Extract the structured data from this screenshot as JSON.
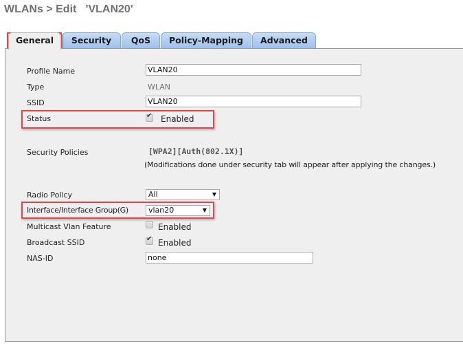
{
  "header": {
    "title": "WLANs > Edit   'VLAN20'"
  },
  "tabs": [
    {
      "label": "General",
      "active": true
    },
    {
      "label": "Security",
      "active": false
    },
    {
      "label": "QoS",
      "active": false
    },
    {
      "label": "Policy-Mapping",
      "active": false
    },
    {
      "label": "Advanced",
      "active": false
    }
  ],
  "general": {
    "profile_name": {
      "label": "Profile Name",
      "value": "VLAN20"
    },
    "type": {
      "label": "Type",
      "value": "WLAN"
    },
    "ssid": {
      "label": "SSID",
      "value": "VLAN20"
    },
    "status": {
      "label": "Status",
      "checked": true,
      "option_label": "Enabled"
    },
    "security_policies": {
      "label": "Security Policies",
      "value": "[WPA2][Auth(802.1X)]",
      "note": "(Modifications done under security tab will appear after applying the changes.)"
    },
    "radio_policy": {
      "label": "Radio Policy",
      "selected": "All"
    },
    "interface": {
      "label": "Interface/Interface Group(G)",
      "selected": "vlan20"
    },
    "multicast_vlan": {
      "label": "Multicast Vlan Feature",
      "checked": false,
      "option_label": "Enabled"
    },
    "broadcast_ssid": {
      "label": "Broadcast SSID",
      "checked": true,
      "option_label": "Enabled"
    },
    "nas_id": {
      "label": "NAS-ID",
      "value": "none"
    }
  },
  "icons": {
    "check": "✔",
    "dropdown_arrow": "▼"
  },
  "colors": {
    "highlight": "#e8434a",
    "tab_blue": "#9fc1ec",
    "panel_bg": "#efefef"
  }
}
